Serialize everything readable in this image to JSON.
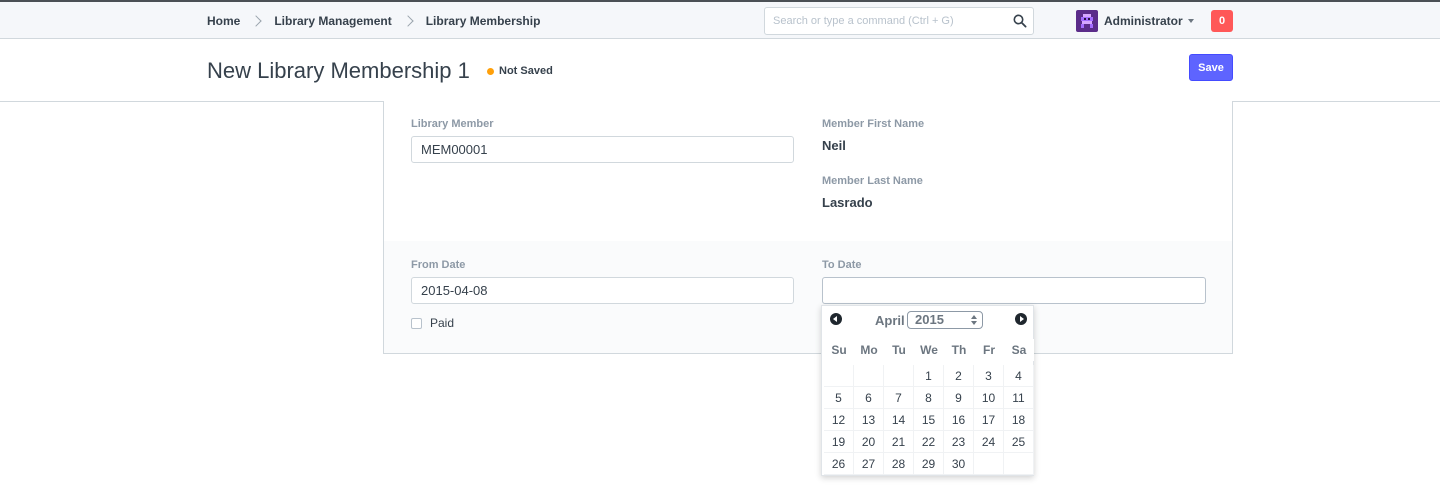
{
  "navbar": {
    "breadcrumbs": [
      "Home",
      "Library Management",
      "Library Membership"
    ],
    "search_placeholder": "Search or type a command (Ctrl + G)",
    "user_name": "Administrator",
    "notification_count": "0"
  },
  "page": {
    "title": "New Library Membership 1",
    "status": "Not Saved",
    "save_label": "Save"
  },
  "form": {
    "library_member": {
      "label": "Library Member",
      "value": "MEM00001"
    },
    "member_first_name": {
      "label": "Member First Name",
      "value": "Neil"
    },
    "member_last_name": {
      "label": "Member Last Name",
      "value": "Lasrado"
    },
    "from_date": {
      "label": "From Date",
      "value": "2015-04-08"
    },
    "to_date": {
      "label": "To Date",
      "value": ""
    },
    "paid": {
      "label": "Paid",
      "checked": false
    }
  },
  "datepicker": {
    "month": "April",
    "year": "2015",
    "weekdays": [
      "Su",
      "Mo",
      "Tu",
      "We",
      "Th",
      "Fr",
      "Sa"
    ],
    "weeks": [
      [
        "",
        "",
        "",
        "1",
        "2",
        "3",
        "4"
      ],
      [
        "5",
        "6",
        "7",
        "8",
        "9",
        "10",
        "11"
      ],
      [
        "12",
        "13",
        "14",
        "15",
        "16",
        "17",
        "18"
      ],
      [
        "19",
        "20",
        "21",
        "22",
        "23",
        "24",
        "25"
      ],
      [
        "26",
        "27",
        "28",
        "29",
        "30",
        "",
        ""
      ]
    ]
  },
  "colors": {
    "primary": "#5e64ff",
    "indicator_orange": "#ffa00a",
    "notification_red": "#ff5858"
  }
}
